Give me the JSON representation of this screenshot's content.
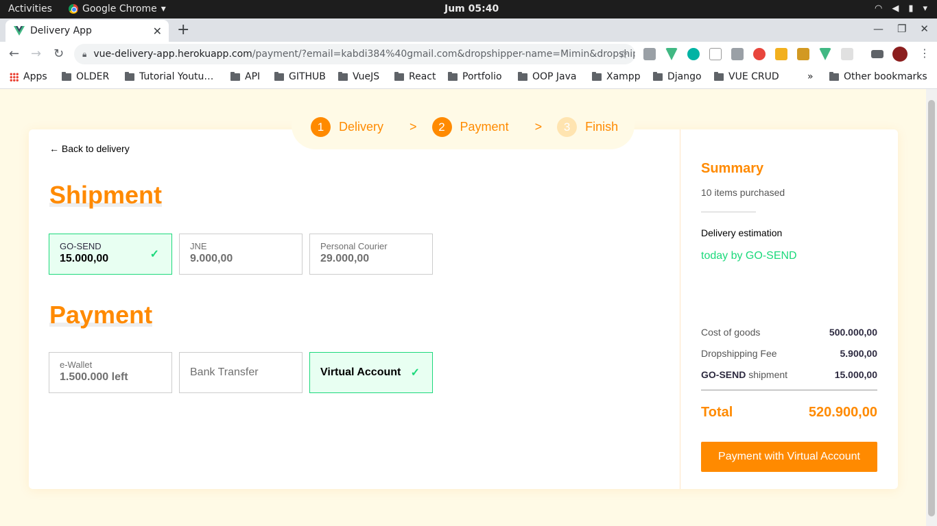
{
  "system": {
    "activities": "Activities",
    "app_name": "Google Chrome",
    "clock": "Jum 05:40"
  },
  "browser": {
    "tab_title": "Delivery App",
    "url_host": "vue-delivery-app.herokuapp.com",
    "url_path": "/payment/?email=kabdi384%40gmail.com&dropshipper-name=Mimin&dropshipper…",
    "bookmarks": [
      "Apps",
      "OLDER",
      "Tutorial Youtu…",
      "API",
      "GITHUB",
      "VueJS",
      "React",
      "Portfolio",
      "OOP Java",
      "Xampp",
      "Django",
      "VUE CRUD"
    ],
    "bookmarks_overflow": "»",
    "other_bookmarks": "Other bookmarks"
  },
  "steps": [
    {
      "num": "1",
      "label": "Delivery"
    },
    {
      "num": "2",
      "label": "Payment"
    },
    {
      "num": "3",
      "label": "Finish"
    }
  ],
  "step_separator": ">",
  "back_link": "← Back to delivery",
  "shipment": {
    "title": "Shipment",
    "options": [
      {
        "label": "GO-SEND",
        "value": "15.000,00",
        "selected": true
      },
      {
        "label": "JNE",
        "value": "9.000,00",
        "selected": false
      },
      {
        "label": "Personal Courier",
        "value": "29.000,00",
        "selected": false
      }
    ]
  },
  "payment": {
    "title": "Payment",
    "options": [
      {
        "label": "e-Wallet",
        "value": "1.500.000 left",
        "selected": false
      },
      {
        "label": "",
        "value": "Bank Transfer",
        "selected": false
      },
      {
        "label": "",
        "value": "Virtual Account",
        "selected": true
      }
    ]
  },
  "summary": {
    "title": "Summary",
    "items_purchased": "10 items purchased",
    "delivery_estimation_label": "Delivery estimation",
    "delivery_estimation_value": "today by GO-SEND",
    "cost_of_goods_label": "Cost of goods",
    "cost_of_goods_value": "500.000,00",
    "dropshipping_fee_label": "Dropshipping Fee",
    "dropshipping_fee_value": "5.900,00",
    "shipment_name": "GO-SEND",
    "shipment_suffix": " shipment",
    "shipment_value": "15.000,00",
    "total_label": "Total",
    "total_value": "520.900,00",
    "pay_button": "Payment with Virtual Account"
  },
  "colors": {
    "accent": "#FF8A00",
    "success": "#1BD97B",
    "page_bg": "#FFFAE6"
  }
}
